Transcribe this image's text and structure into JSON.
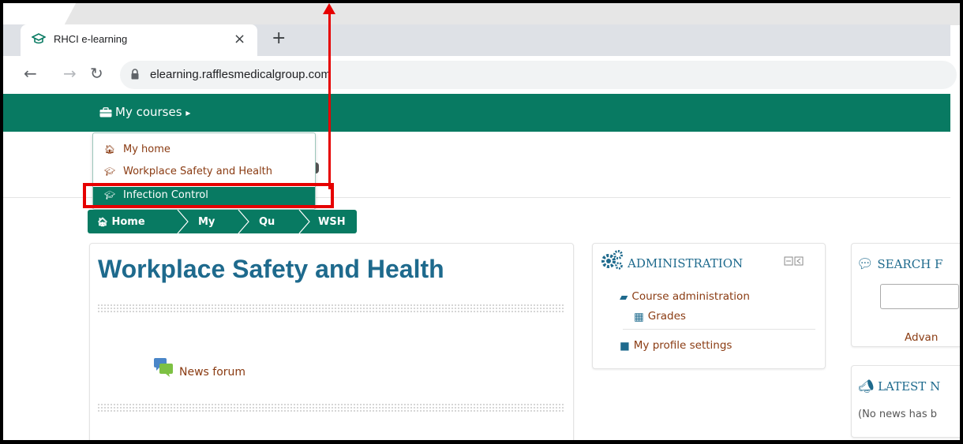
{
  "browser": {
    "tab_title": "RHCI e-learning",
    "close_glyph": "×",
    "newtab_glyph": "+",
    "url": "elearning.rafflesmedicalgroup.com"
  },
  "navbar": {
    "my_courses_label": "My courses",
    "caret": "▸"
  },
  "dropdown": {
    "items": [
      {
        "icon": "home-icon",
        "label": "My home"
      },
      {
        "icon": "graduation-cap-icon",
        "label": "Workplace Safety and Health"
      },
      {
        "icon": "graduation-cap-icon",
        "label": "Infection Control",
        "active": true
      }
    ]
  },
  "breadcrumb": {
    "items": [
      "Home",
      "My",
      "Qu",
      "WSH"
    ]
  },
  "course": {
    "title": "Workplace Safety and Health",
    "forum_label": "News forum"
  },
  "administration": {
    "title": "ADMINISTRATION",
    "course_admin": "Course administration",
    "grades": "Grades",
    "profile_settings": "My profile settings"
  },
  "search_block": {
    "title": "SEARCH F",
    "advanced": "Advan"
  },
  "latest_news": {
    "title": "LATEST N",
    "text": "(No news has b"
  },
  "colors": {
    "brand_green": "#087a62",
    "link_brown": "#8a3b12",
    "heading_blue": "#1e6a8d",
    "annotation_red": "#e60000"
  }
}
